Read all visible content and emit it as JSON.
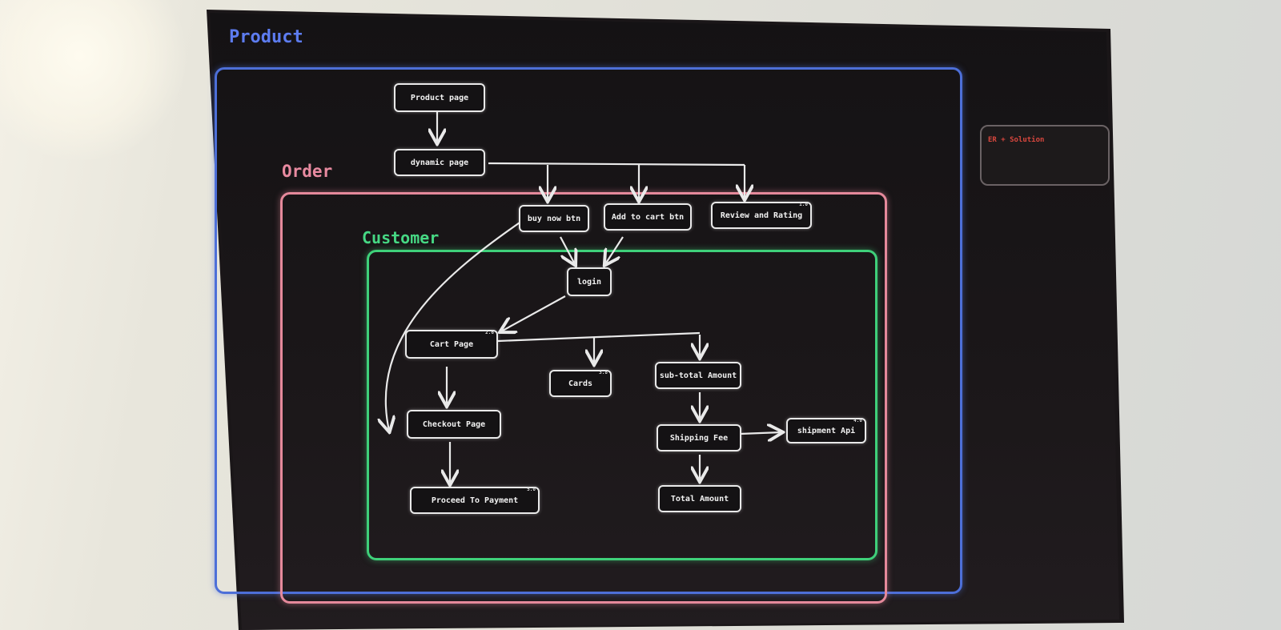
{
  "frames": {
    "product": "Product",
    "order": "Order",
    "customer": "Customer"
  },
  "nodes": {
    "product_page": "Product page",
    "dynamic_page": "dynamic page",
    "buy_now": "buy now btn",
    "add_to_cart": "Add to cart btn",
    "review": "Review and Rating",
    "login": "login",
    "cart_page": "Cart Page",
    "cards": "Cards",
    "subtotal": "sub-total Amount",
    "checkout": "Checkout Page",
    "shipping": "Shipping Fee",
    "shipment_api": "shipment Api",
    "proceed": "Proceed To Payment",
    "total": "Total Amount"
  },
  "side_panel": {
    "title": "ER + Solution",
    "subtitle": ""
  },
  "colors": {
    "product_frame": "#4d6fd8",
    "order_frame": "#e5899b",
    "customer_frame": "#3fd07a",
    "node_border": "#e9e9e9"
  }
}
